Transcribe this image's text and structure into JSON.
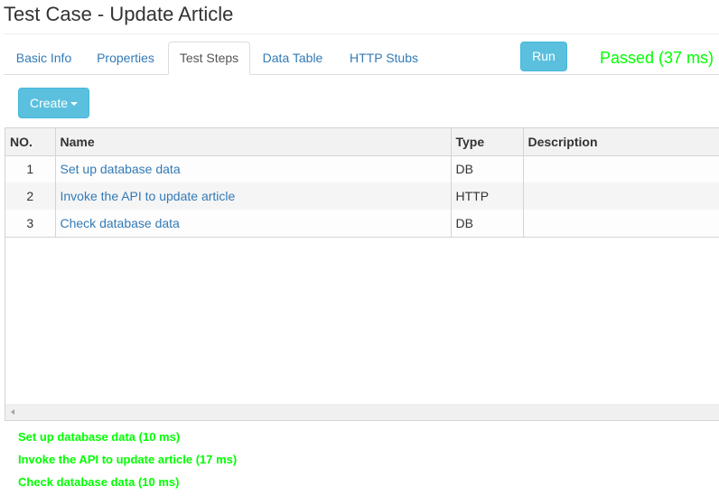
{
  "header": {
    "title": "Test Case - Update Article"
  },
  "tabs": [
    {
      "label": "Basic Info",
      "active": false
    },
    {
      "label": "Properties",
      "active": false
    },
    {
      "label": "Test Steps",
      "active": true
    },
    {
      "label": "Data Table",
      "active": false
    },
    {
      "label": "HTTP Stubs",
      "active": false
    }
  ],
  "toolbar": {
    "run_label": "Run",
    "run_status": "Passed (37 ms)",
    "create_label": "Create",
    "status_color": "#00ff00",
    "accent_color": "#5bc0de"
  },
  "table": {
    "columns": [
      "NO.",
      "Name",
      "Type",
      "Description"
    ],
    "rows": [
      {
        "no": "1",
        "name": "Set up database data",
        "type": "DB",
        "description": ""
      },
      {
        "no": "2",
        "name": "Invoke the API to update article",
        "type": "HTTP",
        "description": ""
      },
      {
        "no": "3",
        "name": "Check database data",
        "type": "DB",
        "description": ""
      }
    ]
  },
  "results": [
    "Set up database data (10 ms)",
    "Invoke the API to update article (17 ms)",
    "Check database data (10 ms)"
  ]
}
